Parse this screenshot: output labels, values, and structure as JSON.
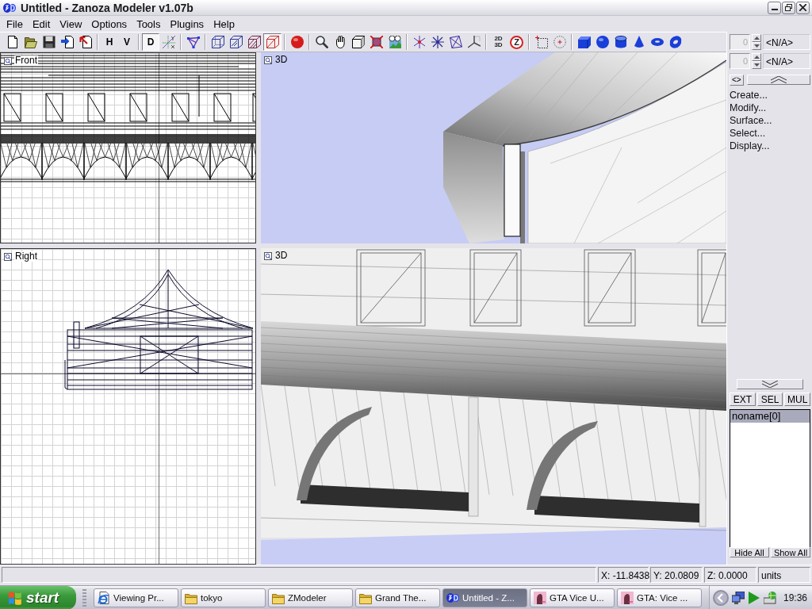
{
  "window": {
    "title": "Untitled - Zanoza Modeler v1.07b"
  },
  "menu": [
    "File",
    "Edit",
    "View",
    "Options",
    "Tools",
    "Plugins",
    "Help"
  ],
  "toolbar": {
    "groups": [
      [
        {
          "kind": "icon",
          "pressed": false
        },
        {
          "kind": "icon",
          "pressed": false
        },
        {
          "kind": "icon",
          "pressed": false
        },
        {
          "kind": "icon",
          "pressed": false
        },
        {
          "kind": "icon",
          "pressed": false
        }
      ],
      [
        {
          "kind": "text",
          "label": "H",
          "pressed": false
        },
        {
          "kind": "text",
          "label": "V",
          "pressed": false
        }
      ],
      [
        {
          "kind": "text",
          "label": "D",
          "pressed": true
        },
        {
          "kind": "icon",
          "pressed": false
        }
      ],
      [
        {
          "kind": "icon",
          "pressed": false
        }
      ],
      [
        {
          "kind": "icon",
          "pressed": false
        },
        {
          "kind": "icon",
          "pressed": false
        },
        {
          "kind": "icon",
          "pressed": false
        },
        {
          "kind": "icon",
          "pressed": true
        }
      ],
      [
        {
          "kind": "icon",
          "pressed": false
        }
      ],
      [
        {
          "kind": "icon",
          "pressed": false
        },
        {
          "kind": "icon",
          "pressed": false
        },
        {
          "kind": "icon",
          "pressed": false
        },
        {
          "kind": "icon",
          "pressed": false
        },
        {
          "kind": "icon",
          "pressed": false
        }
      ],
      [
        {
          "kind": "icon",
          "pressed": false
        },
        {
          "kind": "icon",
          "pressed": false
        },
        {
          "kind": "icon",
          "pressed": false
        },
        {
          "kind": "icon",
          "pressed": false
        }
      ],
      [
        {
          "kind": "stack",
          "labels": [
            "2D",
            "3D"
          ],
          "pressed": false
        },
        {
          "kind": "circle",
          "label": "Z",
          "pressed": false
        }
      ],
      [
        {
          "kind": "icon",
          "pressed": false
        },
        {
          "kind": "icon",
          "pressed": false
        }
      ],
      [
        {
          "kind": "icon",
          "pressed": false
        },
        {
          "kind": "icon",
          "pressed": false
        },
        {
          "kind": "icon",
          "pressed": false
        },
        {
          "kind": "icon",
          "pressed": false
        },
        {
          "kind": "icon",
          "pressed": false
        },
        {
          "kind": "icon",
          "pressed": false
        }
      ]
    ]
  },
  "viewports": [
    {
      "label": "Front",
      "kind": "front"
    },
    {
      "label": "3D",
      "kind": "perspective"
    },
    {
      "label": "Right",
      "kind": "right"
    },
    {
      "label": "3D",
      "kind": "closeup"
    }
  ],
  "side_panel": {
    "spinners": [
      {
        "value": "0",
        "label": "<N/A>",
        "disabled": true
      },
      {
        "value": "0",
        "label": "<N/A>",
        "disabled": true
      }
    ],
    "toggle": "<>",
    "commands": [
      "Create...",
      "Modify...",
      "Surface...",
      "Select...",
      "Display..."
    ],
    "modes": [
      "EXT",
      "SEL",
      "MUL"
    ],
    "objects": [
      {
        "name": "noname[0]",
        "selected": true
      }
    ],
    "list_buttons": [
      "Hide All",
      "Show All"
    ]
  },
  "status_bar": {
    "fields": [
      "X: -11.8438",
      "Y: 20.0809",
      "Z: 0.0000",
      "units"
    ]
  },
  "taskbar": {
    "start": "start",
    "tasks": [
      {
        "label": "Viewing Pr...",
        "kind": "browser",
        "selected": false
      },
      {
        "label": "tokyo",
        "kind": "folder",
        "selected": false
      },
      {
        "label": "ZModeler",
        "kind": "folder",
        "selected": false
      },
      {
        "label": "Grand The...",
        "kind": "folder",
        "selected": false
      },
      {
        "label": "Untitled - Z...",
        "kind": "app",
        "selected": true
      },
      {
        "label": "GTA Vice U...",
        "kind": "game",
        "selected": false
      },
      {
        "label": "GTA: Vice ...",
        "kind": "game",
        "selected": false
      }
    ],
    "clock": "19:36"
  }
}
